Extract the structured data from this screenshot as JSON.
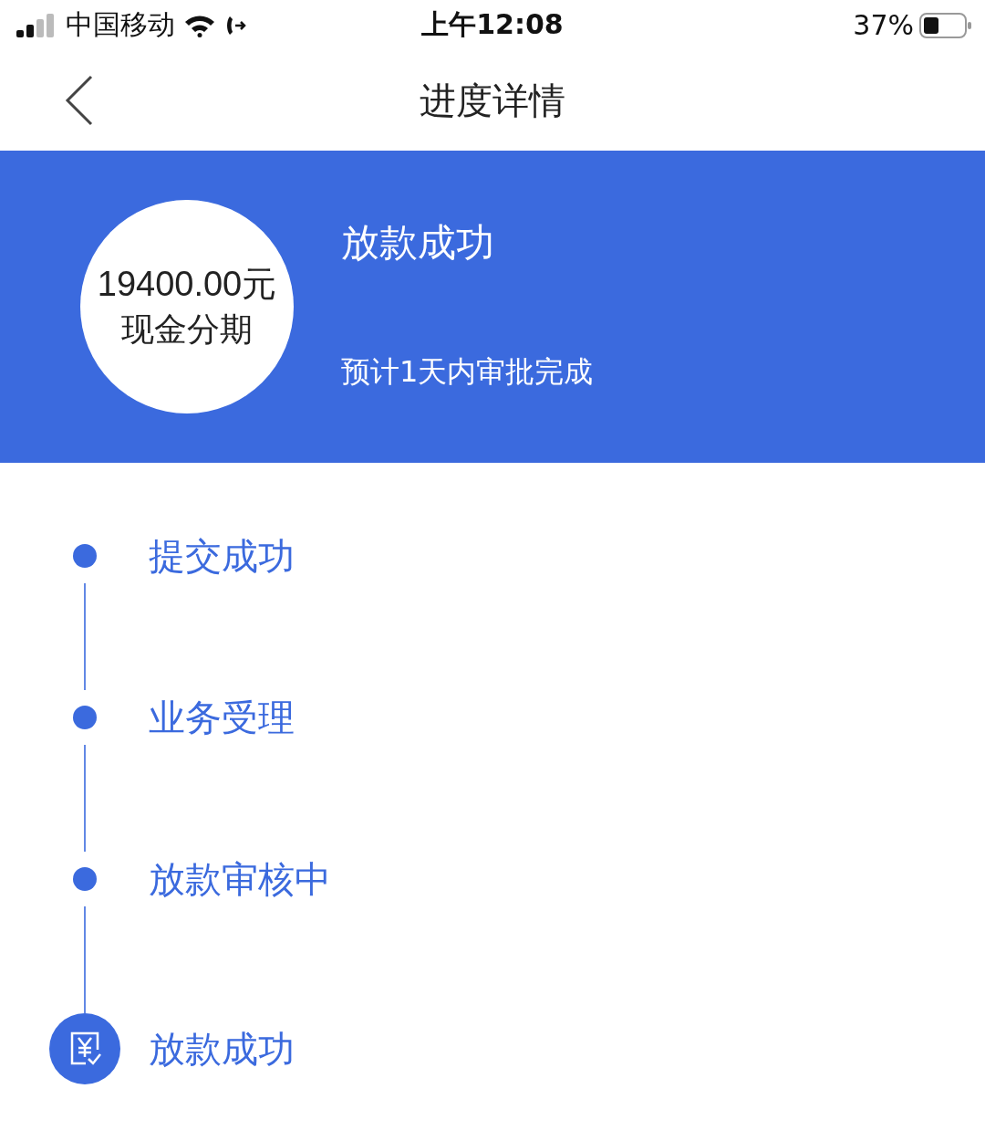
{
  "status_bar": {
    "carrier": "中国移动",
    "time": "上午12:08",
    "battery": "37%"
  },
  "nav": {
    "title": "进度详情"
  },
  "summary": {
    "amount": "19400.00元",
    "product": "现金分期",
    "status": "放款成功",
    "note": "预计1天内审批完成"
  },
  "steps": [
    {
      "kind": "dot",
      "title": "提交成功"
    },
    {
      "kind": "dot",
      "title": "业务受理"
    },
    {
      "kind": "dot",
      "title": "放款审核中"
    },
    {
      "kind": "done",
      "title": "放款成功"
    }
  ]
}
